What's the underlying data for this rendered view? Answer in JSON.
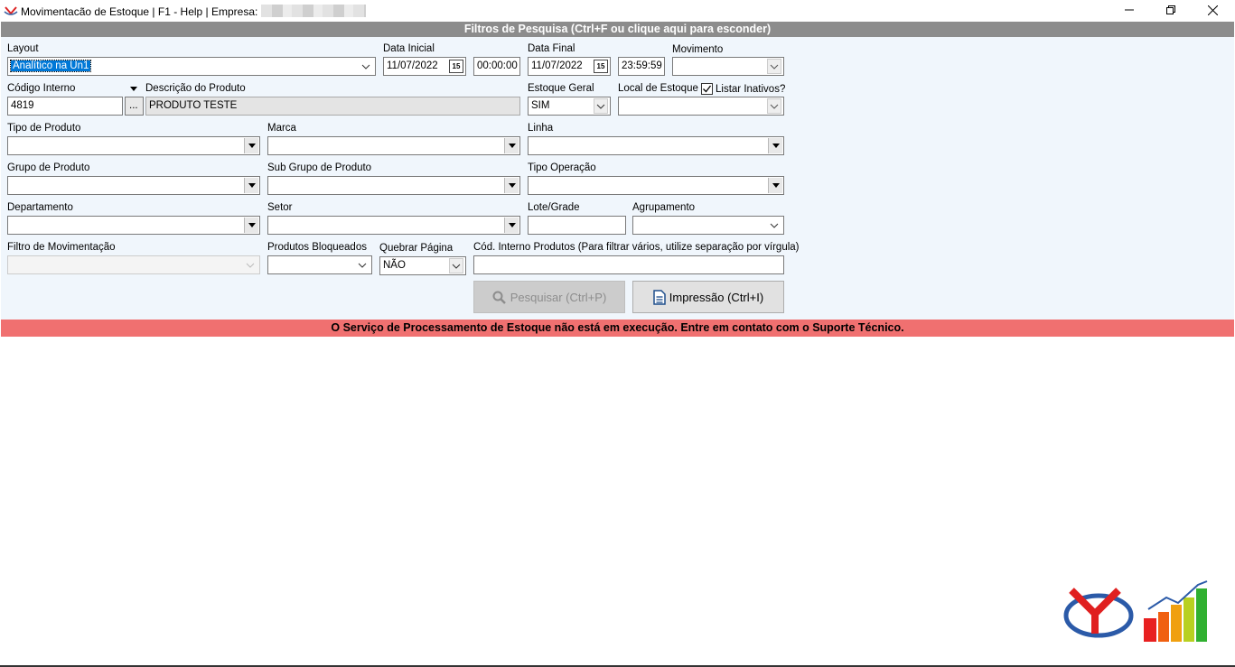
{
  "window": {
    "title": "Movimentacão de Estoque | F1 - Help | Empresa:",
    "minimize_icon": "minimize-icon",
    "restore_icon": "restore-icon",
    "close_icon": "close-icon"
  },
  "filters_header": "Filtros de Pesquisa (Ctrl+F ou clique aqui para esconder)",
  "fields": {
    "layout": {
      "label": "Layout",
      "value": "Analítico na Un1"
    },
    "data_inicial": {
      "label": "Data Inicial",
      "date": "11/07/2022",
      "time": "00:00:00"
    },
    "data_final": {
      "label": "Data Final",
      "date": "11/07/2022",
      "time": "23:59:59"
    },
    "movimento": {
      "label": "Movimento",
      "value": ""
    },
    "codigo_interno": {
      "label": "Código Interno",
      "value": "4819",
      "lookup": "..."
    },
    "descricao_produto": {
      "label": "Descrição do Produto",
      "value": "PRODUTO TESTE"
    },
    "estoque_geral": {
      "label": "Estoque Geral",
      "value": "SIM"
    },
    "local_estoque": {
      "label": "Local de Estoque",
      "value": ""
    },
    "listar_inativos": {
      "label": "Listar Inativos?",
      "checked": true
    },
    "tipo_produto": {
      "label": "Tipo de Produto",
      "value": ""
    },
    "marca": {
      "label": "Marca",
      "value": ""
    },
    "linha": {
      "label": "Linha",
      "value": ""
    },
    "grupo_produto": {
      "label": "Grupo de Produto",
      "value": ""
    },
    "sub_grupo": {
      "label": "Sub Grupo de Produto",
      "value": ""
    },
    "tipo_operacao": {
      "label": "Tipo Operação",
      "value": ""
    },
    "departamento": {
      "label": "Departamento",
      "value": ""
    },
    "setor": {
      "label": "Setor",
      "value": ""
    },
    "lote_grade": {
      "label": "Lote/Grade",
      "value": ""
    },
    "agrupamento": {
      "label": "Agrupamento",
      "value": ""
    },
    "filtro_movimentacao": {
      "label": "Filtro de Movimentação",
      "value": ""
    },
    "produtos_bloqueados": {
      "label": "Produtos Bloqueados",
      "value": ""
    },
    "quebrar_pagina": {
      "label": "Quebrar Página",
      "value": "NÃO"
    },
    "cod_interno_produtos": {
      "label": "Cód. Interno Produtos (Para filtrar vários, utilize separação por vírgula)",
      "value": ""
    }
  },
  "buttons": {
    "pesquisar": "Pesquisar (Ctrl+P)",
    "impressao": "Impressão (Ctrl+I)"
  },
  "status_message": "O Serviço de Processamento de Estoque não está em execução. Entre em contato com o Suporte Técnico.",
  "colors": {
    "header_bg": "#8c8c8c",
    "panel_bg": "#f0f6fc",
    "status_bg": "#f07070",
    "selection": "#0078d7"
  }
}
